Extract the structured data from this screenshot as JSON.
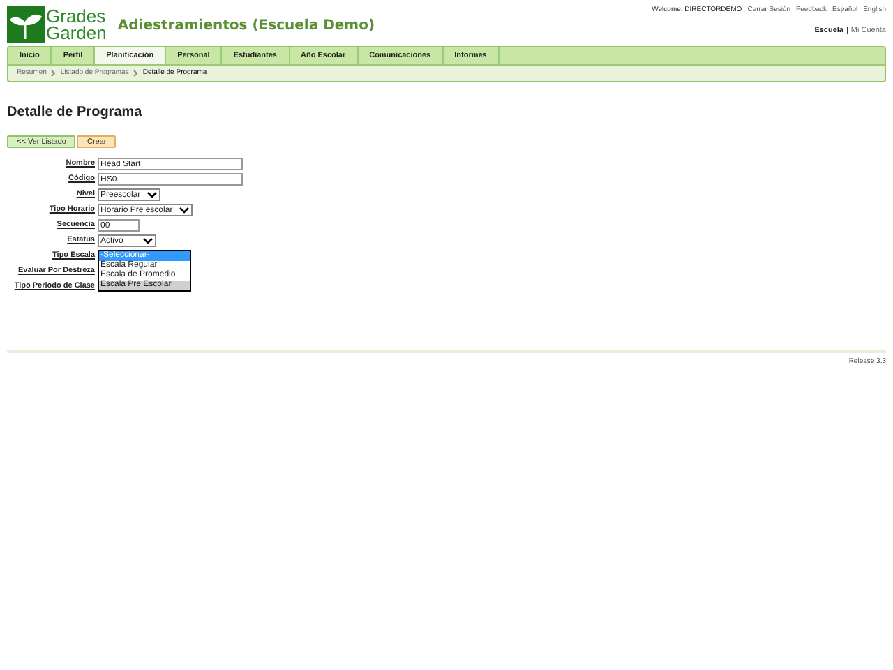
{
  "logo": {
    "line1": "Grades",
    "line2": "Garden"
  },
  "title": "Adiestramientos (Escuela Demo)",
  "top_links": [
    {
      "label": "Welcome: DIRECTORDEMO",
      "kind": "text"
    },
    {
      "label": "Cerrar Sesión",
      "kind": "link"
    },
    {
      "label": "Feedback",
      "kind": "link"
    },
    {
      "label": "Español",
      "kind": "link"
    },
    {
      "label": "English",
      "kind": "link"
    }
  ],
  "account": {
    "school": "Escuela",
    "separator": "|",
    "account": "Mi Cuenta"
  },
  "tabs": [
    {
      "label": "Inicio",
      "selected": false
    },
    {
      "label": "Perfil",
      "selected": false
    },
    {
      "label": "Planificación",
      "selected": true
    },
    {
      "label": "Personal",
      "selected": false
    },
    {
      "label": "Estudiantes",
      "selected": false
    },
    {
      "label": "Año Escolar",
      "selected": false
    },
    {
      "label": "Comunicaciones",
      "selected": false
    },
    {
      "label": "Informes",
      "selected": false
    }
  ],
  "breadcrumbs": [
    {
      "label": "Resumen",
      "current": false
    },
    {
      "label": "Listado de Programas",
      "current": false
    },
    {
      "label": "Detalle de Programa",
      "current": true
    }
  ],
  "heading": "Detalle de Programa",
  "buttons": [
    {
      "label": "<< Ver Listado",
      "kind": "back"
    },
    {
      "label": "Crear",
      "kind": "create"
    }
  ],
  "fields": [
    {
      "label": "Nombre",
      "kind": "text",
      "value": "Head Start"
    },
    {
      "label": "Código",
      "kind": "text",
      "value": "HS0"
    },
    {
      "label": "Nivel",
      "kind": "select",
      "value": "Preescolar"
    },
    {
      "label": "Tipo Horario",
      "kind": "select",
      "value": "Horario Pre escolar"
    },
    {
      "label": "Secuencia",
      "kind": "short",
      "value": "00"
    },
    {
      "label": "Estatus",
      "kind": "select",
      "value": "Activo"
    },
    {
      "label": "Tipo Escala",
      "kind": "open",
      "options": [
        {
          "label": "-Seleccionar-",
          "selected": true,
          "hovered": false
        },
        {
          "label": "Escala Regular",
          "selected": false,
          "hovered": false
        },
        {
          "label": "Escala de Promedio",
          "selected": false,
          "hovered": false
        },
        {
          "label": "Escala Pre Escolar",
          "selected": false,
          "hovered": true
        }
      ]
    },
    {
      "label": "Evaluar Por Destreza",
      "kind": "hidden"
    },
    {
      "label": "Tipo Periodo de Clase",
      "kind": "hidden"
    }
  ],
  "footer": "Release 3.3"
}
